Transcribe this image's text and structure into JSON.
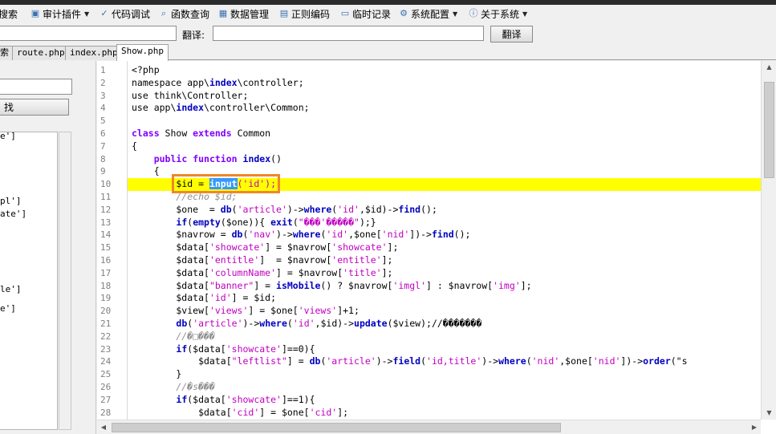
{
  "menu": [
    {
      "label": "搜索",
      "icon": "search-icon",
      "has_arrow": false
    },
    {
      "label": "审计插件",
      "icon": "plugin-icon",
      "has_arrow": true
    },
    {
      "label": "代码调试",
      "icon": "debug-icon",
      "has_arrow": false
    },
    {
      "label": "函数查询",
      "icon": "magnifier-icon",
      "has_arrow": false
    },
    {
      "label": "数据管理",
      "icon": "database-icon",
      "has_arrow": false
    },
    {
      "label": "正则编码",
      "icon": "regex-icon",
      "has_arrow": false
    },
    {
      "label": "临时记录",
      "icon": "note-icon",
      "has_arrow": false
    },
    {
      "label": "系统配置",
      "icon": "gear-icon",
      "has_arrow": true
    },
    {
      "label": "关于系统",
      "icon": "info-icon",
      "has_arrow": true
    }
  ],
  "translate": {
    "source_value": "",
    "label": "翻译:",
    "target_value": "",
    "button_label": "翻译"
  },
  "tabs": [
    {
      "label": "索",
      "active": false
    },
    {
      "label": "route.php",
      "active": false
    },
    {
      "label": "index.php",
      "active": false
    },
    {
      "label": "Show.php",
      "active": true
    }
  ],
  "left_panel": {
    "search_value": "",
    "find_button_label": "找",
    "tree_items": [
      "e']",
      "pl']",
      "ate']",
      "le']",
      "e']"
    ]
  },
  "editor": {
    "highlight_line": 10,
    "lines": [
      {
        "n": "1",
        "t": "<?php"
      },
      {
        "n": "2",
        "t": "namespace app\\index\\controller;"
      },
      {
        "n": "3",
        "t": "use think\\Controller;"
      },
      {
        "n": "4",
        "t": "use app\\index\\controller\\Common;"
      },
      {
        "n": "5",
        "t": ""
      },
      {
        "n": "6",
        "t": "class Show extends Common"
      },
      {
        "n": "7",
        "t": "{"
      },
      {
        "n": "8",
        "t": "    public function index()"
      },
      {
        "n": "9",
        "t": "    {"
      },
      {
        "n": "10",
        "t": "        $id = input('id');"
      },
      {
        "n": "11",
        "t": "        //echo $id;"
      },
      {
        "n": "12",
        "t": "        $one  = db('article')->where('id',$id)->find();"
      },
      {
        "n": "13",
        "t": "        if(empty($one)){ exit(\"���'�����\");}"
      },
      {
        "n": "14",
        "t": "        $navrow = db('nav')->where('id',$one['nid'])->find();"
      },
      {
        "n": "15",
        "t": "        $data['showcate'] = $navrow['showcate'];"
      },
      {
        "n": "16",
        "t": "        $data['entitle']  = $navrow['entitle'];"
      },
      {
        "n": "17",
        "t": "        $data['columnName'] = $navrow['title'];"
      },
      {
        "n": "18",
        "t": "        $data[\"banner\"] = isMobile() ? $navrow['imgl'] : $navrow['img'];"
      },
      {
        "n": "19",
        "t": "        $data['id'] = $id;"
      },
      {
        "n": "20",
        "t": "        $view['views'] = $one['views']+1;"
      },
      {
        "n": "21",
        "t": "        db('article')->where('id',$id)->update($view);//�������"
      },
      {
        "n": "22",
        "t": "        //�□���"
      },
      {
        "n": "23",
        "t": "        if($data['showcate']==0){"
      },
      {
        "n": "24",
        "t": "            $data[\"leftlist\"] = db('article')->field('id,title')->where('nid',$one['nid'])->order(\"s"
      },
      {
        "n": "25",
        "t": "        }"
      },
      {
        "n": "26",
        "t": "        //�s���"
      },
      {
        "n": "27",
        "t": "        if($data['showcate']==1){"
      },
      {
        "n": "28",
        "t": "            $data['cid'] = $one['cid'];"
      }
    ]
  },
  "colors": {
    "highlight": "#ffff00",
    "selection": "#3399ff",
    "annotation_box": "#f0872a",
    "keyword": "#8000ff",
    "string": "#c000c0"
  }
}
